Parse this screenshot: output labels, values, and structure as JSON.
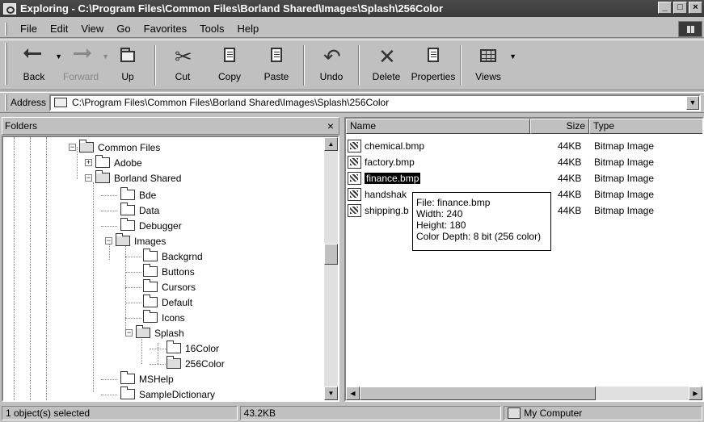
{
  "window": {
    "title": "Exploring - C:\\Program Files\\Common Files\\Borland Shared\\Images\\Splash\\256Color"
  },
  "menu": [
    "File",
    "Edit",
    "View",
    "Go",
    "Favorites",
    "Tools",
    "Help"
  ],
  "toolbar": {
    "back": "Back",
    "forward": "Forward",
    "up": "Up",
    "cut": "Cut",
    "copy": "Copy",
    "paste": "Paste",
    "undo": "Undo",
    "delete": "Delete",
    "properties": "Properties",
    "views": "Views"
  },
  "address": {
    "label": "Address",
    "value": "C:\\Program Files\\Common Files\\Borland Shared\\Images\\Splash\\256Color"
  },
  "folders": {
    "title": "Folders",
    "close": "×",
    "items": [
      "Common Files",
      "Adobe",
      "Borland Shared",
      "Bde",
      "Data",
      "Debugger",
      "Images",
      "Backgrnd",
      "Buttons",
      "Cursors",
      "Default",
      "Icons",
      "Splash",
      "16Color",
      "256Color",
      "MSHelp",
      "SampleDictionary"
    ]
  },
  "columns": {
    "name": "Name",
    "size": "Size",
    "type": "Type"
  },
  "files": [
    {
      "name": "chemical.bmp",
      "size": "44KB",
      "type": "Bitmap Image"
    },
    {
      "name": "factory.bmp",
      "size": "44KB",
      "type": "Bitmap Image"
    },
    {
      "name": "finance.bmp",
      "size": "44KB",
      "type": "Bitmap Image"
    },
    {
      "name": "handshak",
      "size": "44KB",
      "type": "Bitmap Image"
    },
    {
      "name": "shipping.b",
      "size": "44KB",
      "type": "Bitmap Image"
    }
  ],
  "tooltip": {
    "file": "File: finance.bmp",
    "width": "Width: 240",
    "height": "Height: 180",
    "depth": "Color Depth: 8 bit (256 color)"
  },
  "status": {
    "selected": "1 object(s) selected",
    "size": "43.2KB",
    "location": "My Computer"
  }
}
